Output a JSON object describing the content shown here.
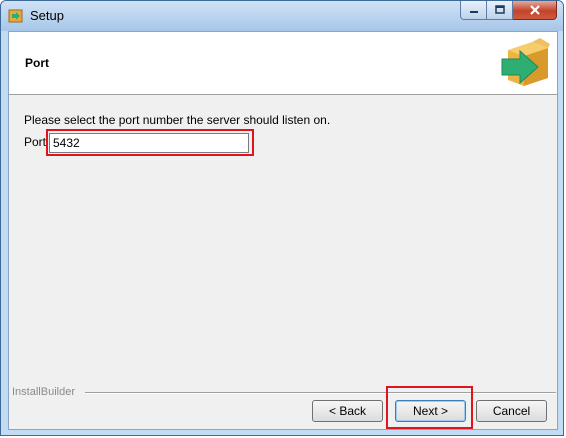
{
  "window": {
    "title": "Setup"
  },
  "header": {
    "title": "Port",
    "logo_icon": "box-arrow-icon"
  },
  "main": {
    "description": "Please select the port number the server should listen on.",
    "port_label": "Port",
    "port_value": "5432"
  },
  "footer": {
    "brand": "InstallBuilder",
    "back_label": "< Back",
    "next_label": "Next >",
    "cancel_label": "Cancel"
  },
  "colors": {
    "highlight": "#e0141c",
    "arrow": "#2fae74",
    "box": "#f0b43c"
  }
}
